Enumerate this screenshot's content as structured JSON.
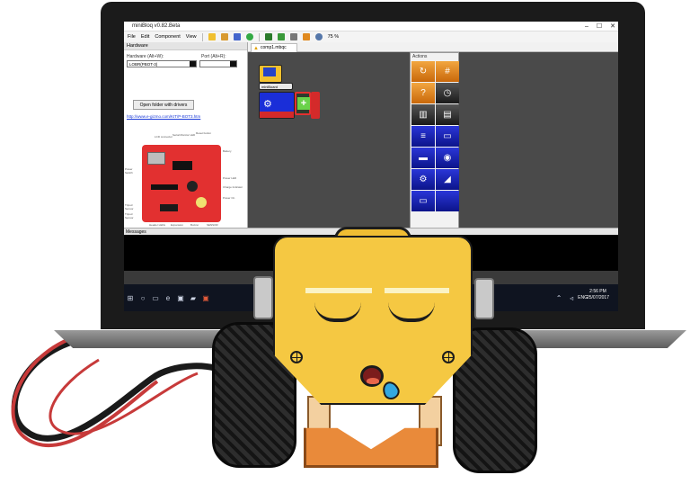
{
  "window": {
    "title": "miniBloq v0.82.Beta",
    "menu": [
      "File",
      "Edit",
      "Component",
      "View"
    ],
    "zoom": "75 %"
  },
  "hardware_panel": {
    "header": "Hardware",
    "hardware_label": "Hardware (Alt+W):",
    "hardware_value": "LOBR(PBOT-3)",
    "port_label": "Port (Alt+R):",
    "drivers_button": "Open folder with drivers",
    "link": "http://www.e-gizmo.com/KIT/P-BOT3.htm",
    "board_labels": [
      "LCD connector",
      "Serial Monitor LED",
      "Reset button",
      "Battery",
      "Power LED",
      "Charge Indicator",
      "Power On",
      "Power Switch",
      "Tripod Sensor",
      "Tripod Sensor",
      "Header LEDs",
      "Expansion Buttons",
      "Buzzer",
      "SENSOR connector"
    ]
  },
  "editor": {
    "tab_label": "comp1.mbqc",
    "block_label": "miniBoard"
  },
  "actions": {
    "header": "Actions",
    "icons": [
      "refresh-icon",
      "number-icon",
      "question-icon",
      "clock-icon",
      "trash-icon",
      "bin-icon",
      "equals-icon",
      "monitor-icon",
      "display-icon",
      "speaker-icon",
      "gears-icon",
      "motor-icon",
      "lcd-icon",
      ""
    ]
  },
  "messages": {
    "header": "Messages"
  },
  "taskbar": {
    "language": "ENG",
    "time": "2:56 PM",
    "date": "25/07/2017"
  },
  "colors": {
    "robot_body": "#f5c842",
    "wire": "#c73a3a",
    "palette_blue": "#1a22b8",
    "board_red": "#e23030"
  }
}
